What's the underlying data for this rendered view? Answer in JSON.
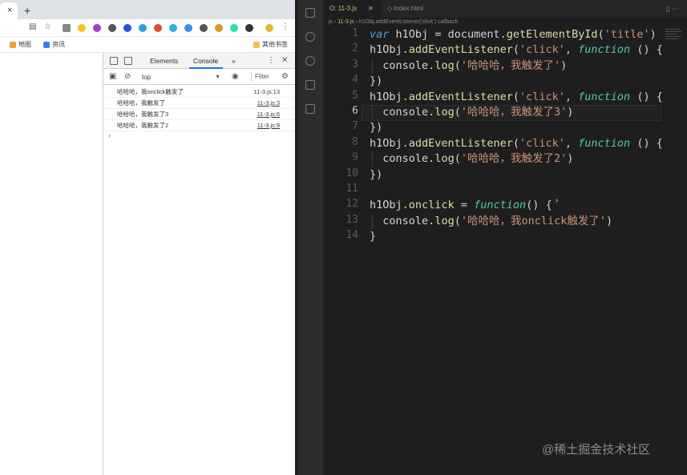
{
  "browser": {
    "new_tab_glyph": "+",
    "close_glyph": "×",
    "bookmarks": [
      {
        "label": "地图",
        "color": "#e9a23b"
      },
      {
        "label": "资讯",
        "color": "#3b7be9"
      },
      {
        "label": "其他书签",
        "color": "#f2c14e"
      }
    ],
    "extension_colors": [
      "#888888",
      "#f5c518",
      "#a23bd1",
      "#555555",
      "#2b50e0",
      "#2ba0e0",
      "#e04b2b",
      "#2bb0e0",
      "#3b8de9",
      "#555555",
      "#e0962b",
      "#2be0b0",
      "#333333",
      "#e0b62b",
      "#e02b6b",
      "#888888"
    ]
  },
  "devtools": {
    "tabs": {
      "elements": "Elements",
      "console": "Console",
      "more": "»"
    },
    "context": "top",
    "filter_placeholder": "Filter",
    "logs": [
      {
        "msg": "哈哈哈，我onclick触发了",
        "src": "11-3.js:13"
      },
      {
        "msg": "哈哈哈，我触发了",
        "src": "11-3.js:3"
      },
      {
        "msg": "哈哈哈，我触发了3",
        "src": "11-3.js:6"
      },
      {
        "msg": "哈哈哈，我触发了2",
        "src": "11-3.js:9"
      }
    ],
    "prompt": "›"
  },
  "editor": {
    "tabs": [
      {
        "label": "O: 11-3.js",
        "active": true
      },
      {
        "label": "index.html",
        "active": false
      }
    ],
    "breadcrumb": {
      "folder": "js",
      "file": "11-3.js",
      "symbol": "h1Obj.addEventListener('click') callback"
    },
    "line_numbers": [
      "1",
      "2",
      "3",
      "4",
      "5",
      "6",
      "7",
      "8",
      "9",
      "10",
      "11",
      "12",
      "13",
      "14"
    ],
    "code_lines": [
      "var h1Obj = document.getElementById('title')",
      "h1Obj.addEventListener('click', function () {",
      "  console.log('哈哈哈，我触发了')",
      "})",
      "h1Obj.addEventListener('click', function () {",
      "  console.log('哈哈哈，我触发了3')",
      "})",
      "h1Obj.addEventListener('click', function () {",
      "  console.log('哈哈哈，我触发了2')",
      "})",
      "",
      "h1Obj.onclick = function() {",
      "  console.log('哈哈哈，我onclick触发了')",
      "}"
    ]
  },
  "watermark": "@稀土掘金技术社区"
}
